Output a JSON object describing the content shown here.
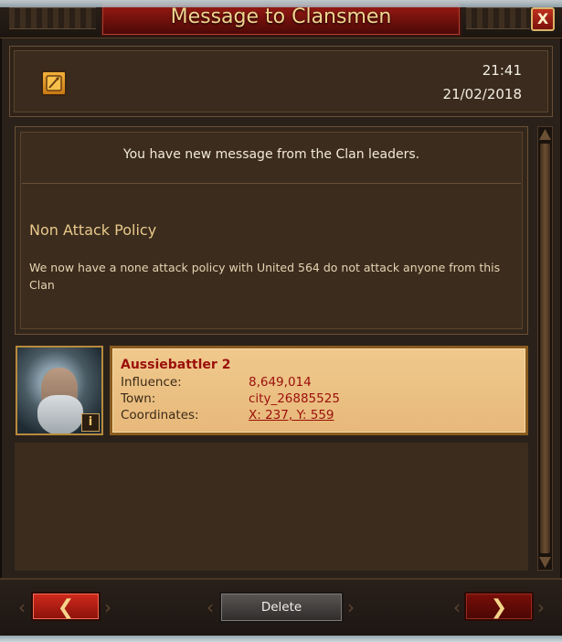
{
  "window": {
    "title": "Message to Clansmen",
    "close_label": "X"
  },
  "header": {
    "time": "21:41",
    "date": "21/02/2018"
  },
  "message": {
    "notice": "You have new message from the Clan leaders.",
    "subject": "Non Attack Policy",
    "body": "We now have a none attack policy with United 564 do not attack anyone from this Clan"
  },
  "sender": {
    "name": "Aussiebattler 2",
    "info_label": "i",
    "fields": [
      {
        "label": "Influence:",
        "value": "8,649,014"
      },
      {
        "label": "Town:",
        "value": "city_26885525"
      },
      {
        "label": "Coordinates:",
        "value": "X: 237, Y: 559"
      }
    ]
  },
  "footer": {
    "prev_label": "❮",
    "next_label": "❯",
    "delete_label": "Delete"
  },
  "colors": {
    "title_red": "#9c1b14",
    "gold_text": "#f2d58f",
    "card_bg": "#f0c98d",
    "value_red": "#9a0f0b"
  },
  "icons": {
    "message": "quill-scroll-icon",
    "close": "close-icon",
    "info": "info-icon",
    "prev": "chevron-left-icon",
    "next": "chevron-right-icon"
  }
}
